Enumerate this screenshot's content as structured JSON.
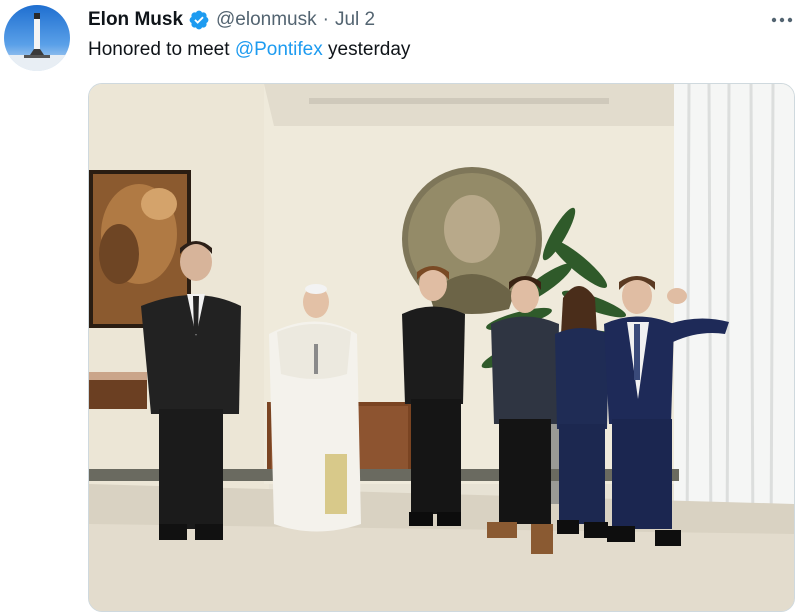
{
  "tweet": {
    "display_name": "Elon Musk",
    "handle": "@elonmusk",
    "separator": "·",
    "date": "Jul 2",
    "text_before": "Honored to meet ",
    "mention": "@Pontifex",
    "text_after": " yesterday",
    "verified": true
  },
  "icons": {
    "avatar": "rocket-landing-avatar",
    "verified": "verified-badge-icon",
    "more": "more-options-icon"
  },
  "colors": {
    "link": "#1d9bf0",
    "verified": "#1d9bf0",
    "name": "#0f1419",
    "secondary": "#536471"
  }
}
